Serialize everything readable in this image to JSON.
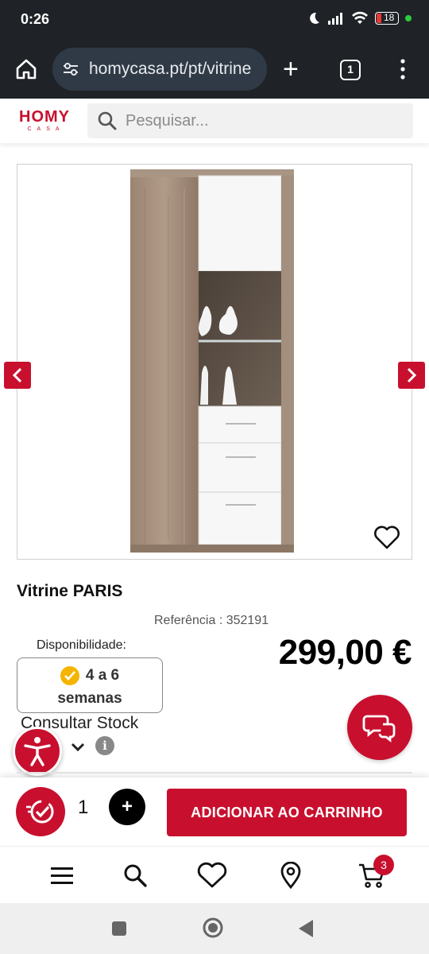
{
  "status": {
    "time": "0:26",
    "battery": "18"
  },
  "browser": {
    "url": "homycasa.pt/pt/vitrine",
    "tab_count": "1"
  },
  "site": {
    "logo_main": "HOMY",
    "logo_sub": "CASA",
    "search_placeholder": "Pesquisar..."
  },
  "product": {
    "title": "Vitrine PARIS",
    "reference": "Referência : 352191",
    "availability_label": "Disponibilidade:",
    "availability_value_line1": "4 a 6",
    "availability_value_line2": "semanas",
    "price": "299,00 €",
    "stock_link": "Consultar Stock"
  },
  "cart": {
    "quantity": "1",
    "plus_label": "+",
    "add_button": "ADICIONAR AO CARRINHO"
  },
  "bottom_nav": {
    "cart_badge": "3"
  },
  "colors": {
    "brand_red": "#c8102e",
    "dark_bar": "#1f2327",
    "check_yellow": "#f4b400"
  }
}
